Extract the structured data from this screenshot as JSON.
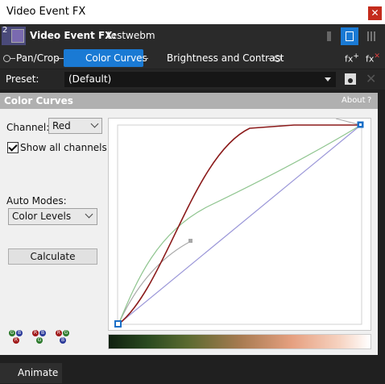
{
  "window": {
    "title": "Video Event FX",
    "close_icon": "close-icon"
  },
  "header": {
    "track_number": "2",
    "label": "Video Event FX:",
    "clip_name": "testwebm"
  },
  "chain": {
    "items": [
      {
        "label": "Pan/Crop",
        "checked": null
      },
      {
        "label": "Color Curves",
        "checked": true,
        "selected": true
      },
      {
        "label": "Brightness and Contrast",
        "checked": true
      }
    ],
    "fx_add": "fx",
    "fx_remove": "fx"
  },
  "preset": {
    "label": "Preset:",
    "value": "(Default)"
  },
  "panel": {
    "title": "Color Curves",
    "about": "About",
    "help": "?",
    "channel_label": "Channel:",
    "channel_value": "Red",
    "show_all_label": "Show all channels",
    "show_all_checked": true,
    "auto_modes_label": "Auto Modes:",
    "auto_modes_value": "Color Levels",
    "calculate_label": "Calculate",
    "channel_colors": {
      "red": "#8b1a1a",
      "green": "#8fc58f",
      "blue": "#9a96d8",
      "gray": "#a8a8a8"
    },
    "swap_buttons": [
      {
        "top": [
          "G",
          "B"
        ],
        "bottom": "R"
      },
      {
        "top": [
          "R",
          "B"
        ],
        "bottom": "G"
      },
      {
        "top": [
          "R",
          "G"
        ],
        "bottom": "B"
      }
    ]
  },
  "footer": {
    "animate_label": "Animate"
  }
}
